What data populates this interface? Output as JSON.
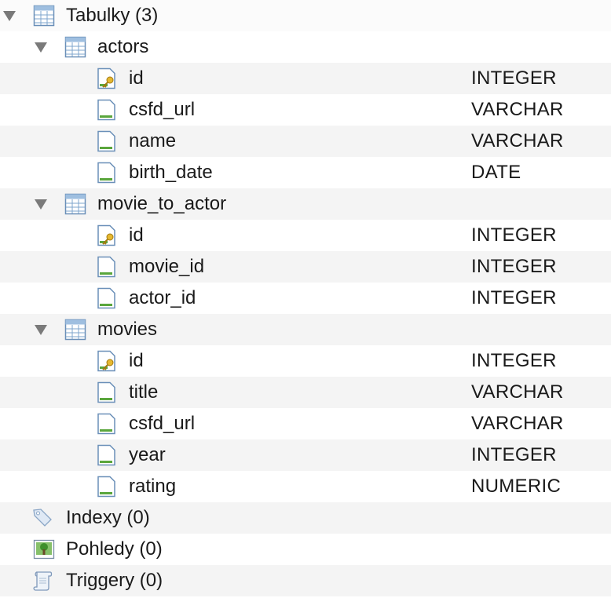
{
  "tree": {
    "tables": {
      "label": "Tabulky (3)",
      "icon": "table-icon",
      "items": [
        {
          "name": "actors",
          "columns": [
            {
              "name": "id",
              "type": "INTEGER",
              "icon": "primary-key-column-icon"
            },
            {
              "name": "csfd_url",
              "type": "VARCHAR",
              "icon": "column-icon"
            },
            {
              "name": "name",
              "type": "VARCHAR",
              "icon": "column-icon"
            },
            {
              "name": "birth_date",
              "type": "DATE",
              "icon": "column-icon"
            }
          ]
        },
        {
          "name": "movie_to_actor",
          "columns": [
            {
              "name": "id",
              "type": "INTEGER",
              "icon": "primary-key-column-icon"
            },
            {
              "name": "movie_id",
              "type": "INTEGER",
              "icon": "column-icon"
            },
            {
              "name": "actor_id",
              "type": "INTEGER",
              "icon": "column-icon"
            }
          ]
        },
        {
          "name": "movies",
          "columns": [
            {
              "name": "id",
              "type": "INTEGER",
              "icon": "primary-key-column-icon"
            },
            {
              "name": "title",
              "type": "VARCHAR",
              "icon": "column-icon"
            },
            {
              "name": "csfd_url",
              "type": "VARCHAR",
              "icon": "column-icon"
            },
            {
              "name": "year",
              "type": "INTEGER",
              "icon": "column-icon"
            },
            {
              "name": "rating",
              "type": "NUMERIC",
              "icon": "column-icon"
            }
          ]
        }
      ]
    },
    "indexes": {
      "label": "Indexy (0)",
      "icon": "tag-icon"
    },
    "views": {
      "label": "Pohledy (0)",
      "icon": "view-icon"
    },
    "triggers": {
      "label": "Triggery (0)",
      "icon": "scroll-icon"
    }
  }
}
